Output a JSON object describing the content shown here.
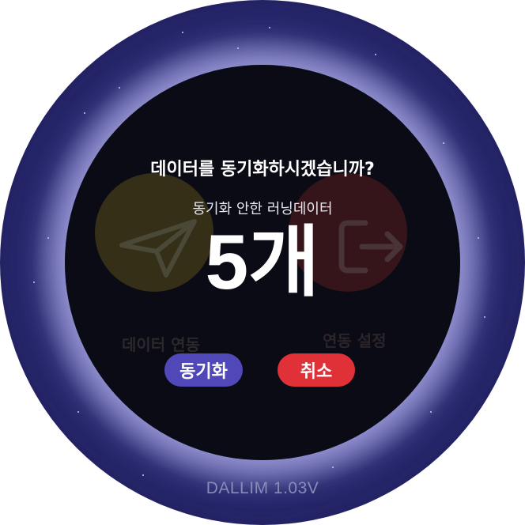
{
  "dialog": {
    "title": "데이터를 동기화하시겠습니까?",
    "subtitle": "동기화 안한 러닝데이터",
    "count": "5개"
  },
  "buttons": {
    "sync_label": "동기화",
    "cancel_label": "취소"
  },
  "background_menu": {
    "left_label": "데이터 연동",
    "left_icon": "send-icon",
    "right_label": "연동 설정",
    "right_icon": "exit-icon"
  },
  "footer": {
    "version": "DALLIM 1.03V"
  },
  "colors": {
    "sync_button": "#5048b8",
    "cancel_button": "#e03038",
    "bezel": "#24246a",
    "screen": "#0d0d16"
  }
}
